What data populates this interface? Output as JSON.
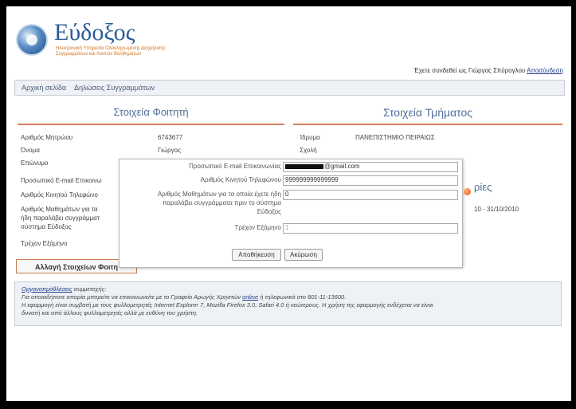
{
  "header": {
    "logo_title": "Εύδοξος",
    "logo_sub1": "Ηλεκτρονική Υπηρεσία Ολοκληρωμένης Διαχείρισης",
    "logo_sub2": "Συγγραμμάτων και Λοιπών Βοηθημάτων",
    "login_text": "Έχετε συνδεθεί ως Γιώργος Σπύρογλου",
    "logout_label": "Αποσύνδεση"
  },
  "nav": {
    "items": [
      "Αρχική σελίδα",
      "Δηλώσεις Συγγραμμάτων"
    ]
  },
  "student": {
    "title": "Στοιχεία Φοιτητή",
    "am_label": "Αριθμός Μητρώου",
    "am_value": "6743677",
    "name_label": "Όνομα",
    "name_value": "Γιώργος",
    "surname_label": "Επώνυμο",
    "email_label": "Προσωπικό E-mail Επικοινω",
    "phone_label": "Αριθμός Κινητού Τηλεφώνο",
    "count_label_1": "Αριθμός Μαθημάτων για τα",
    "count_label_2": "ήδη παραλάβει συγγράμματ",
    "count_label_3": "σύστημα Εύδοξος",
    "semester_label": "Τρέχον Εξάμηνο",
    "change_button": "Αλλαγή Στοιχείων Φοιτη"
  },
  "department": {
    "title": "Στοιχεία Τμήματος",
    "institution_label": "Ίδρυμα",
    "institution_value": "ΠΑΝΕΠΙΣΤΗΜΙΟ ΠΕΙΡΑΙΩΣ",
    "school_label": "Σχολή",
    "periods_title_fragment": "ρίες",
    "period_fragment": "10 - 31/10/2010"
  },
  "notice": {
    "link_text": "Οργανοπμόθλέσεις",
    "line1_rest": " συμμετοχής:",
    "line2_a": "Για οποιαδήποτε απορία μπορείτε να επικοινωνείτε με το Γραφείο Αρωγής Χρηστών ",
    "line2_link": "online",
    "line2_b": " ή τηλεφωνικά στο 801-11-13600.",
    "line3": "Η εφαρμογή είναι συμβατή με τους φυλλομετρητές Internet Explorer 7, Mozilla Firefox 3.0, Safari 4.0 ή νεώτερους. Η χρήση της εφαρμογής ενδέχεται να είναι",
    "line4": "δυνατή και από άλλους φυλλομετρητές αλλά με ευθύνη του χρήστη."
  },
  "dialog": {
    "email_label": "Προσωπικό E-mail Επικοινωνίας",
    "email_value": "@gmail.com",
    "phone_label": "Αριθμός Κινητού Τηλεφώνου",
    "phone_value": "999999999999999",
    "count_label_1": "Αριθμός Μαθημάτων για τα οποία έχετε ήδη",
    "count_label_2": "παραλάβει συγγράμματα πριν το σύστημα",
    "count_label_3": "Εύδοξος",
    "count_value": "0",
    "semester_label": "Τρέχον Εξάμηνο",
    "semester_value": "1",
    "save_button": "Αποθήκευση",
    "cancel_button": "Ακύρωση"
  }
}
